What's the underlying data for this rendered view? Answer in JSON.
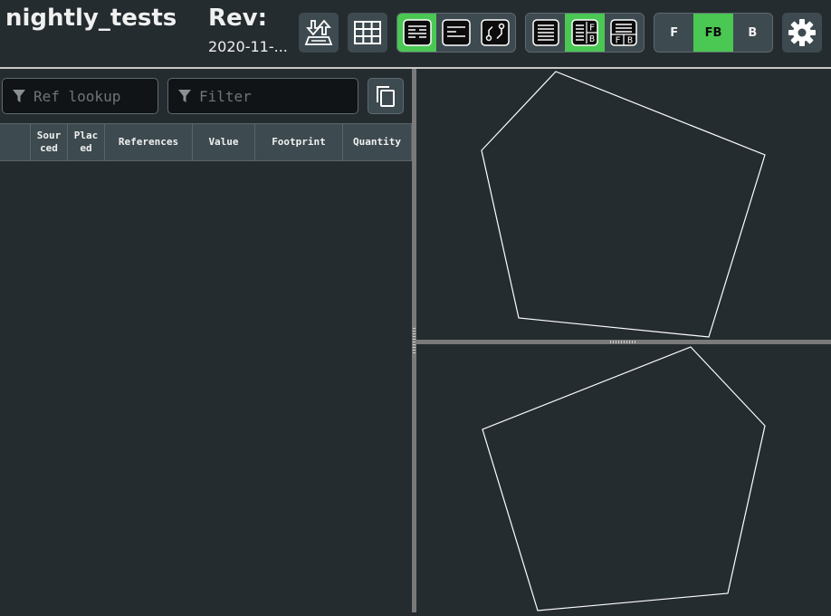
{
  "header": {
    "title": "nightly_tests",
    "rev_label": "Rev:",
    "rev_value": "2020-11-..."
  },
  "toolbar": {
    "icons": {
      "file": "upload-file-icon",
      "grid": "grid-icon",
      "layout_bom": "bom-layout-icon",
      "layout_list": "list-layout-icon",
      "layout_pcb": "pcb-layout-icon",
      "split_single": "single-table-icon",
      "split_fb": "front-back-columns-icon",
      "split_fb_rows": "front-back-rows-icon",
      "settings": "gear-icon"
    },
    "layer_buttons": [
      "F",
      "FB",
      "B"
    ],
    "layer_selected": "FB",
    "layout_selected": "bom-layout",
    "bom_mode_selected": "front-back-columns"
  },
  "filters": {
    "ref_lookup_placeholder": "Ref lookup",
    "filter_placeholder": "Filter"
  },
  "table": {
    "columns": [
      "",
      "Sourced",
      "Placed",
      "References",
      "Value",
      "Footprint",
      "Quantity"
    ],
    "column_display": [
      "",
      "Sour ced",
      "Plac ed",
      "References",
      "Value",
      "Footprint",
      "Quantity"
    ],
    "rows": []
  },
  "colors": {
    "background": "#252c30",
    "button": "#3d4a4f",
    "accent": "#4bc753",
    "outline": "#ffffff"
  }
}
